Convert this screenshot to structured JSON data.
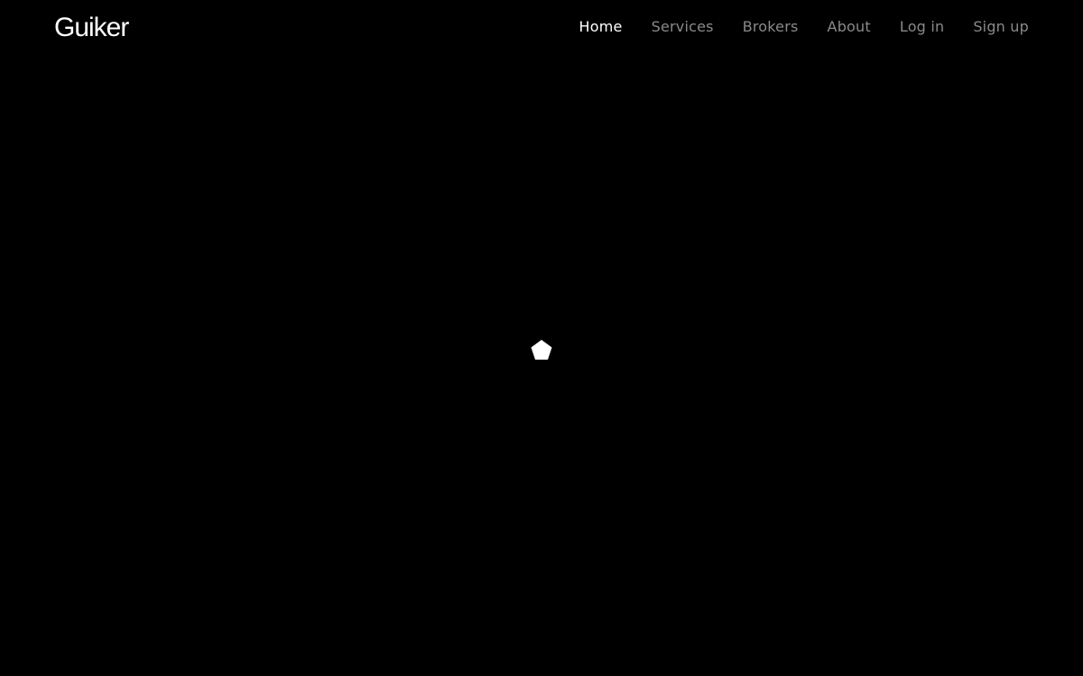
{
  "brand": {
    "name": "Guiker"
  },
  "nav": {
    "items": [
      {
        "label": "Home",
        "active": true
      },
      {
        "label": "Services",
        "active": false
      },
      {
        "label": "Brokers",
        "active": false
      },
      {
        "label": "About",
        "active": false
      },
      {
        "label": "Log in",
        "active": false
      },
      {
        "label": "Sign up",
        "active": false
      }
    ]
  },
  "loader": {
    "icon": "pentagon-spinner-icon"
  },
  "colors": {
    "background": "#000000",
    "text_active": "#ffffff",
    "text_muted": "#8a8a8a"
  }
}
